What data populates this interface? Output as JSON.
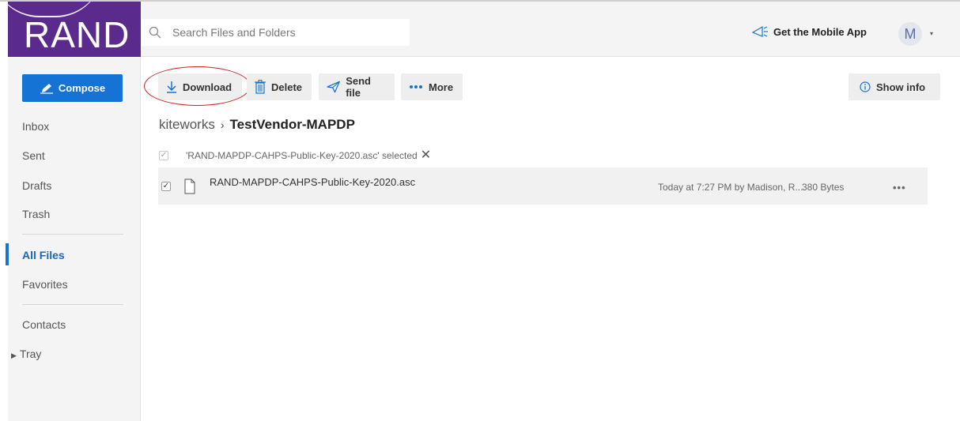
{
  "logo": {
    "text": "RAND"
  },
  "header": {
    "search_placeholder": "Search Files and Folders",
    "mobile_app_label": "Get the Mobile App",
    "avatar_initial": "M",
    "avatar_caret": "▾"
  },
  "sidebar": {
    "compose_label": "Compose",
    "items": [
      {
        "label": "Inbox"
      },
      {
        "label": "Sent"
      },
      {
        "label": "Drafts"
      },
      {
        "label": "Trash"
      },
      {
        "label": "All Files"
      },
      {
        "label": "Favorites"
      },
      {
        "label": "Contacts"
      },
      {
        "label": "Tray"
      }
    ],
    "active_item": "All Files"
  },
  "toolbar": {
    "download_label": "Download",
    "delete_label": "Delete",
    "send_file_label": "Send file",
    "more_label": "More",
    "show_info_label": "Show info"
  },
  "breadcrumb": {
    "root": "kiteworks",
    "separator": "›",
    "current": "TestVendor-MAPDP"
  },
  "selection": {
    "text": "'RAND-MAPDP-CAHPS-Public-Key-2020.asc' selected",
    "close_glyph": "✕"
  },
  "files": [
    {
      "name": "RAND-MAPDP-CAHPS-Public-Key-2020.asc",
      "modified": "Today at 7:27 PM by Madison, R...",
      "size": "380 Bytes",
      "more_glyph": "•••",
      "checked": true
    }
  ],
  "colors": {
    "brand_purple": "#5a2a8c",
    "primary_blue": "#1673d6",
    "highlight_red": "#d21f1f"
  },
  "icons": [
    "search-icon",
    "megaphone-icon",
    "pencil-icon",
    "download-icon",
    "trash-icon",
    "send-icon",
    "more-dots-icon",
    "info-icon",
    "file-icon",
    "close-icon"
  ]
}
